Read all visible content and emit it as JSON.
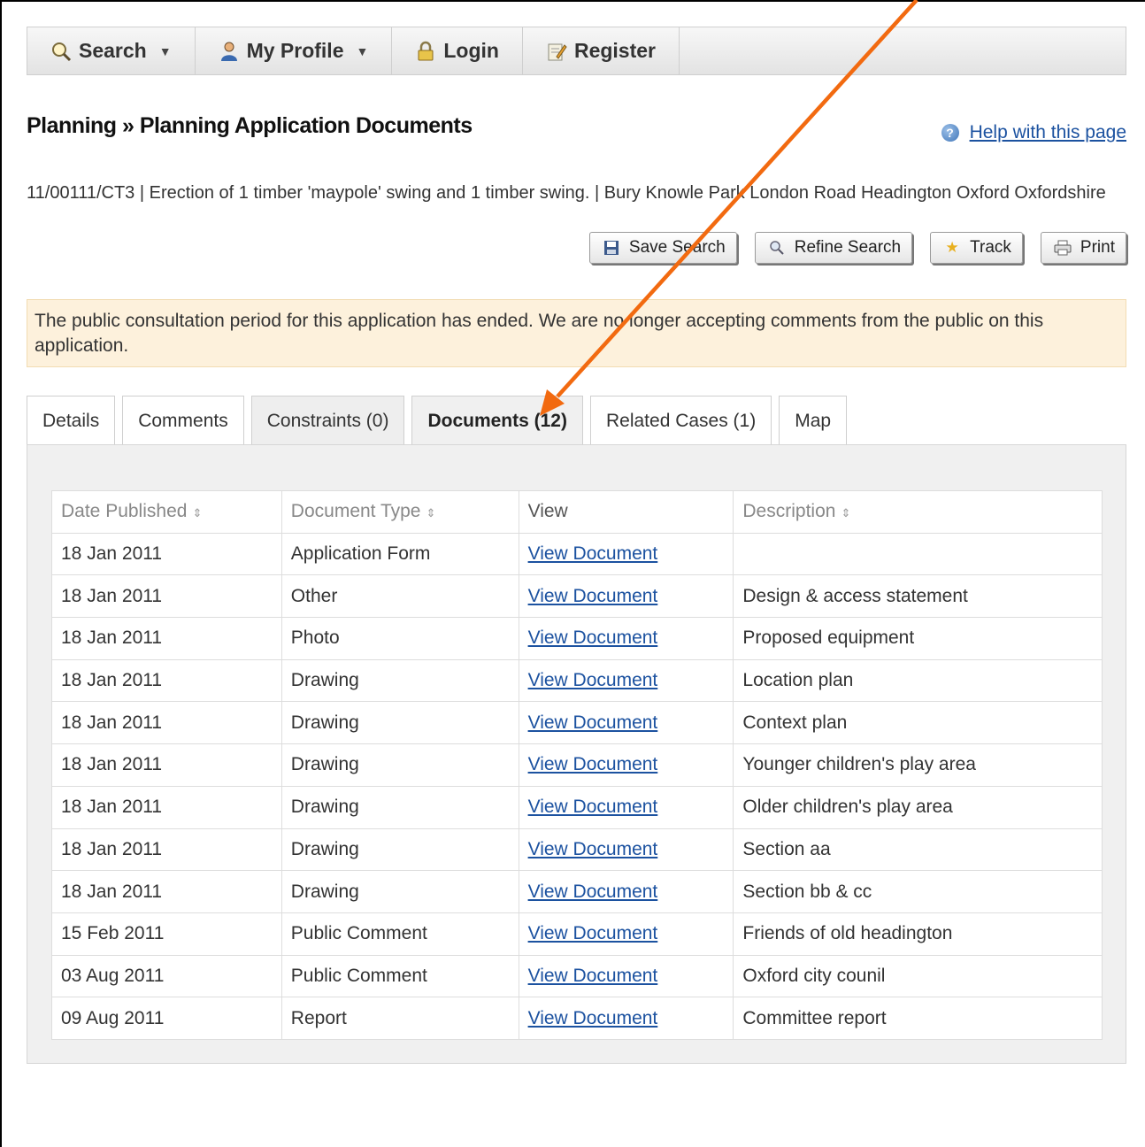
{
  "nav": {
    "items": [
      {
        "label": "Search",
        "icon": "search-icon",
        "dropdown": true
      },
      {
        "label": "My Profile",
        "icon": "user-icon",
        "dropdown": true
      },
      {
        "label": "Login",
        "icon": "lock-icon",
        "dropdown": false
      },
      {
        "label": "Register",
        "icon": "edit-icon",
        "dropdown": false
      }
    ]
  },
  "page": {
    "breadcrumb": "Planning » Planning Application Documents",
    "help_link": "Help with this page",
    "case_summary": "11/00111/CT3 | Erection of 1 timber 'maypole' swing and 1 timber swing. | Bury Knowle Park London Road Headington Oxford Oxfordshire"
  },
  "actions": {
    "save_search": "Save Search",
    "refine_search": "Refine Search",
    "track": "Track",
    "print": "Print"
  },
  "notice": "The public consultation period for this application has ended. We are no longer accepting comments from the public on this application.",
  "tabs": [
    "Details",
    "Comments",
    "Constraints (0)",
    "Documents (12)",
    "Related Cases (1)",
    "Map"
  ],
  "active_tab": "Documents (12)",
  "table": {
    "headers": {
      "date": "Date Published",
      "type": "Document Type",
      "view": "View",
      "description": "Description"
    },
    "rows": [
      {
        "date": "18 Jan 2011",
        "type": "Application Form",
        "view": "View Document",
        "description": ""
      },
      {
        "date": "18 Jan 2011",
        "type": "Other",
        "view": "View Document",
        "description": "Design & access statement"
      },
      {
        "date": "18 Jan 2011",
        "type": "Photo",
        "view": "View Document",
        "description": "Proposed equipment"
      },
      {
        "date": "18 Jan 2011",
        "type": "Drawing",
        "view": "View Document",
        "description": "Location plan"
      },
      {
        "date": "18 Jan 2011",
        "type": "Drawing",
        "view": "View Document",
        "description": "Context plan"
      },
      {
        "date": "18 Jan 2011",
        "type": "Drawing",
        "view": "View Document",
        "description": "Younger children's play area"
      },
      {
        "date": "18 Jan 2011",
        "type": "Drawing",
        "view": "View Document",
        "description": "Older children's play area"
      },
      {
        "date": "18 Jan 2011",
        "type": "Drawing",
        "view": "View Document",
        "description": "Section aa"
      },
      {
        "date": "18 Jan 2011",
        "type": "Drawing",
        "view": "View Document",
        "description": "Section bb & cc"
      },
      {
        "date": "15 Feb 2011",
        "type": "Public Comment",
        "view": "View Document",
        "description": "Friends of old headington"
      },
      {
        "date": "03 Aug 2011",
        "type": "Public Comment",
        "view": "View Document",
        "description": "Oxford city counil"
      },
      {
        "date": "09 Aug 2011",
        "type": "Report",
        "view": "View Document",
        "description": "Committee report"
      }
    ]
  },
  "colors": {
    "link": "#1c52a0",
    "notice_bg": "#fdf1dc",
    "annotation_arrow": "#f26a10"
  }
}
